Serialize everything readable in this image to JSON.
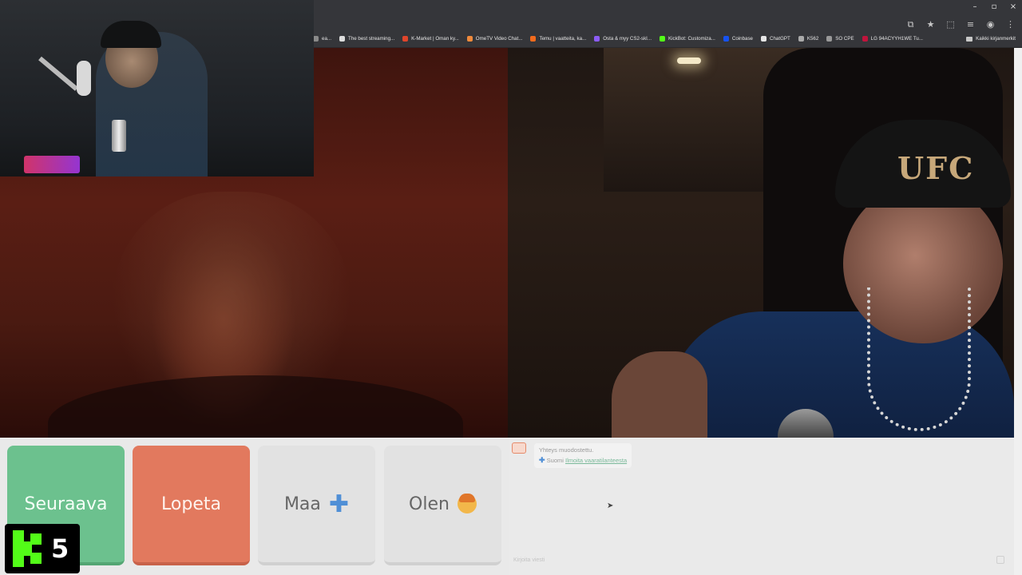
{
  "browser": {
    "window_controls": [
      "–",
      "▫",
      "×"
    ],
    "bookmarks": [
      {
        "label": "ea...",
        "color": "#8a8a8a"
      },
      {
        "label": "The best streaming...",
        "color": "#dddddd"
      },
      {
        "label": "K-Market | Oman ky...",
        "color": "#e0452b"
      },
      {
        "label": "OmeTV Video Chat...",
        "color": "#f08a3c"
      },
      {
        "label": "Temu | vaatteita, ka...",
        "color": "#f26b1d"
      },
      {
        "label": "Osta & myy CS2-skI...",
        "color": "#8b5cf6"
      },
      {
        "label": "KickBot: Customiza...",
        "color": "#53fc18"
      },
      {
        "label": "Coinbase",
        "color": "#1652f0"
      },
      {
        "label": "ChatGPT",
        "color": "#e6e6e6"
      },
      {
        "label": "K562",
        "color": "#aaaaaa"
      },
      {
        "label": "SO CPE",
        "color": "#999999"
      },
      {
        "label": "LG 94ACYYH1WE Tu...",
        "color": "#c0143c"
      }
    ],
    "all_bookmarks_label": "Kaikki kirjanmerkit"
  },
  "controls": {
    "next_label": "Seuraava",
    "stop_label": "Lopeta",
    "country_label": "Maa",
    "me_label": "Olen"
  },
  "chat": {
    "status_message": "Yhteys muodostettu.",
    "country_prefix": "Suomi",
    "country_link": "Ilmoita vaaratilanteesta",
    "input_placeholder": "Kirjoita viesti"
  },
  "overlay": {
    "kick_count": "5",
    "cap_logo_text": "UFC"
  },
  "colors": {
    "next": "#6cc18e",
    "stop": "#e2795e",
    "kick_green": "#53fc18"
  }
}
